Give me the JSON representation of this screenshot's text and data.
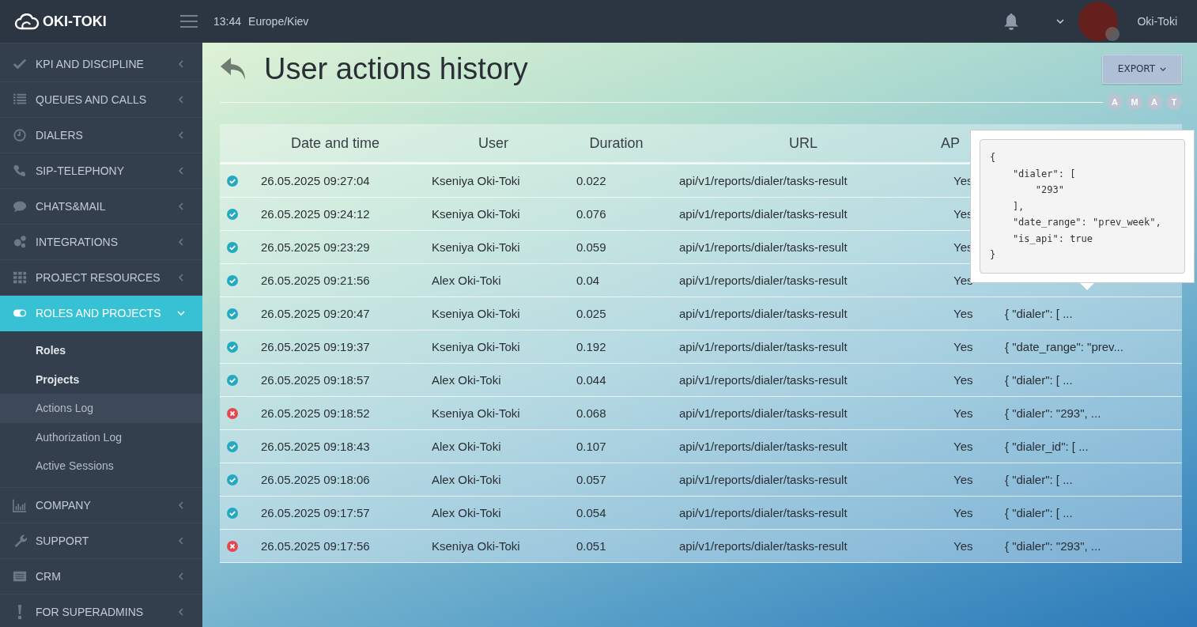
{
  "topbar": {
    "brand": "OKI-TOKI",
    "time": "13:44",
    "timezone": "Europe/Kiev",
    "user": "Oki-Toki"
  },
  "sidebar": {
    "items": [
      {
        "label": "KPI AND DISCIPLINE",
        "expanded": false,
        "selected": false
      },
      {
        "label": "QUEUES AND CALLS",
        "expanded": false,
        "selected": false
      },
      {
        "label": "DIALERS",
        "expanded": false,
        "selected": false
      },
      {
        "label": "SIP-TELEPHONY",
        "expanded": false,
        "selected": false
      },
      {
        "label": "CHATS&MAIL",
        "expanded": false,
        "selected": false
      },
      {
        "label": "INTEGRATIONS",
        "expanded": false,
        "selected": false
      },
      {
        "label": "PROJECT RESOURCES",
        "expanded": false,
        "selected": false
      },
      {
        "label": "ROLES AND PROJECTS",
        "expanded": true,
        "selected": true,
        "children": [
          {
            "label": "Roles",
            "kind": "section",
            "selected": false
          },
          {
            "label": "Projects",
            "kind": "section",
            "selected": false
          },
          {
            "label": "Actions Log",
            "kind": "link",
            "selected": true
          },
          {
            "label": "Authorization Log",
            "kind": "link",
            "selected": false
          },
          {
            "label": "Active Sessions",
            "kind": "link",
            "selected": false
          }
        ]
      },
      {
        "label": "COMPANY",
        "expanded": false,
        "selected": false
      },
      {
        "label": "SUPPORT",
        "expanded": false,
        "selected": false
      },
      {
        "label": "CRM",
        "expanded": false,
        "selected": false
      },
      {
        "label": "FOR SUPERADMINS",
        "expanded": false,
        "selected": false
      }
    ]
  },
  "page": {
    "title": "User actions history",
    "export_button": "EXPORT",
    "avatars": [
      "A",
      "M",
      "A",
      "T"
    ]
  },
  "table": {
    "columns": [
      "Date and time",
      "User",
      "Duration",
      "URL",
      "AP"
    ],
    "rows": [
      {
        "ok": true,
        "date": "26.05.2025 09:27:04",
        "user": "Kseniya Oki-Toki",
        "duration": "0.022",
        "url": "api/v1/reports/dialer/tasks-result",
        "api": "Yes"
      },
      {
        "ok": true,
        "date": "26.05.2025 09:24:12",
        "user": "Kseniya Oki-Toki",
        "duration": "0.076",
        "url": "api/v1/reports/dialer/tasks-result",
        "api": "Yes"
      },
      {
        "ok": true,
        "date": "26.05.2025 09:23:29",
        "user": "Kseniya Oki-Toki",
        "duration": "0.059",
        "url": "api/v1/reports/dialer/tasks-result",
        "api": "Yes"
      },
      {
        "ok": true,
        "date": "26.05.2025 09:21:56",
        "user": "Alex Oki-Toki",
        "duration": "0.04",
        "url": "api/v1/reports/dialer/tasks-result",
        "api": "Yes"
      },
      {
        "ok": true,
        "date": "26.05.2025 09:20:47",
        "user": "Kseniya Oki-Toki",
        "duration": "0.025",
        "url": "api/v1/reports/dialer/tasks-result",
        "api": "Yes",
        "params": "{ \"dialer\": [ ..."
      },
      {
        "ok": true,
        "date": "26.05.2025 09:19:37",
        "user": "Kseniya Oki-Toki",
        "duration": "0.192",
        "url": "api/v1/reports/dialer/tasks-result",
        "api": "Yes",
        "params": "{ \"date_range\": \"prev..."
      },
      {
        "ok": true,
        "date": "26.05.2025 09:18:57",
        "user": "Alex Oki-Toki",
        "duration": "0.044",
        "url": "api/v1/reports/dialer/tasks-result",
        "api": "Yes",
        "params": "{ \"dialer\": [ ..."
      },
      {
        "ok": false,
        "date": "26.05.2025 09:18:52",
        "user": "Kseniya Oki-Toki",
        "duration": "0.068",
        "url": "api/v1/reports/dialer/tasks-result",
        "api": "Yes",
        "params": "{ \"dialer\": \"293\", ..."
      },
      {
        "ok": true,
        "date": "26.05.2025 09:18:43",
        "user": "Alex Oki-Toki",
        "duration": "0.107",
        "url": "api/v1/reports/dialer/tasks-result",
        "api": "Yes",
        "params": "{ \"dialer_id\": [ ..."
      },
      {
        "ok": true,
        "date": "26.05.2025 09:18:06",
        "user": "Alex Oki-Toki",
        "duration": "0.057",
        "url": "api/v1/reports/dialer/tasks-result",
        "api": "Yes",
        "params": "{ \"dialer\": [ ..."
      },
      {
        "ok": true,
        "date": "26.05.2025 09:17:57",
        "user": "Alex Oki-Toki",
        "duration": "0.054",
        "url": "api/v1/reports/dialer/tasks-result",
        "api": "Yes",
        "params": "{ \"dialer\": [ ..."
      },
      {
        "ok": false,
        "date": "26.05.2025 09:17:56",
        "user": "Kseniya Oki-Toki",
        "duration": "0.051",
        "url": "api/v1/reports/dialer/tasks-result",
        "api": "Yes",
        "params": "{ \"dialer\": \"293\", ..."
      }
    ]
  },
  "popover": {
    "code": "{\n    \"dialer\": [\n        \"293\"\n    ],\n    \"date_range\": \"prev_week\",\n    \"is_api\": true\n}"
  }
}
